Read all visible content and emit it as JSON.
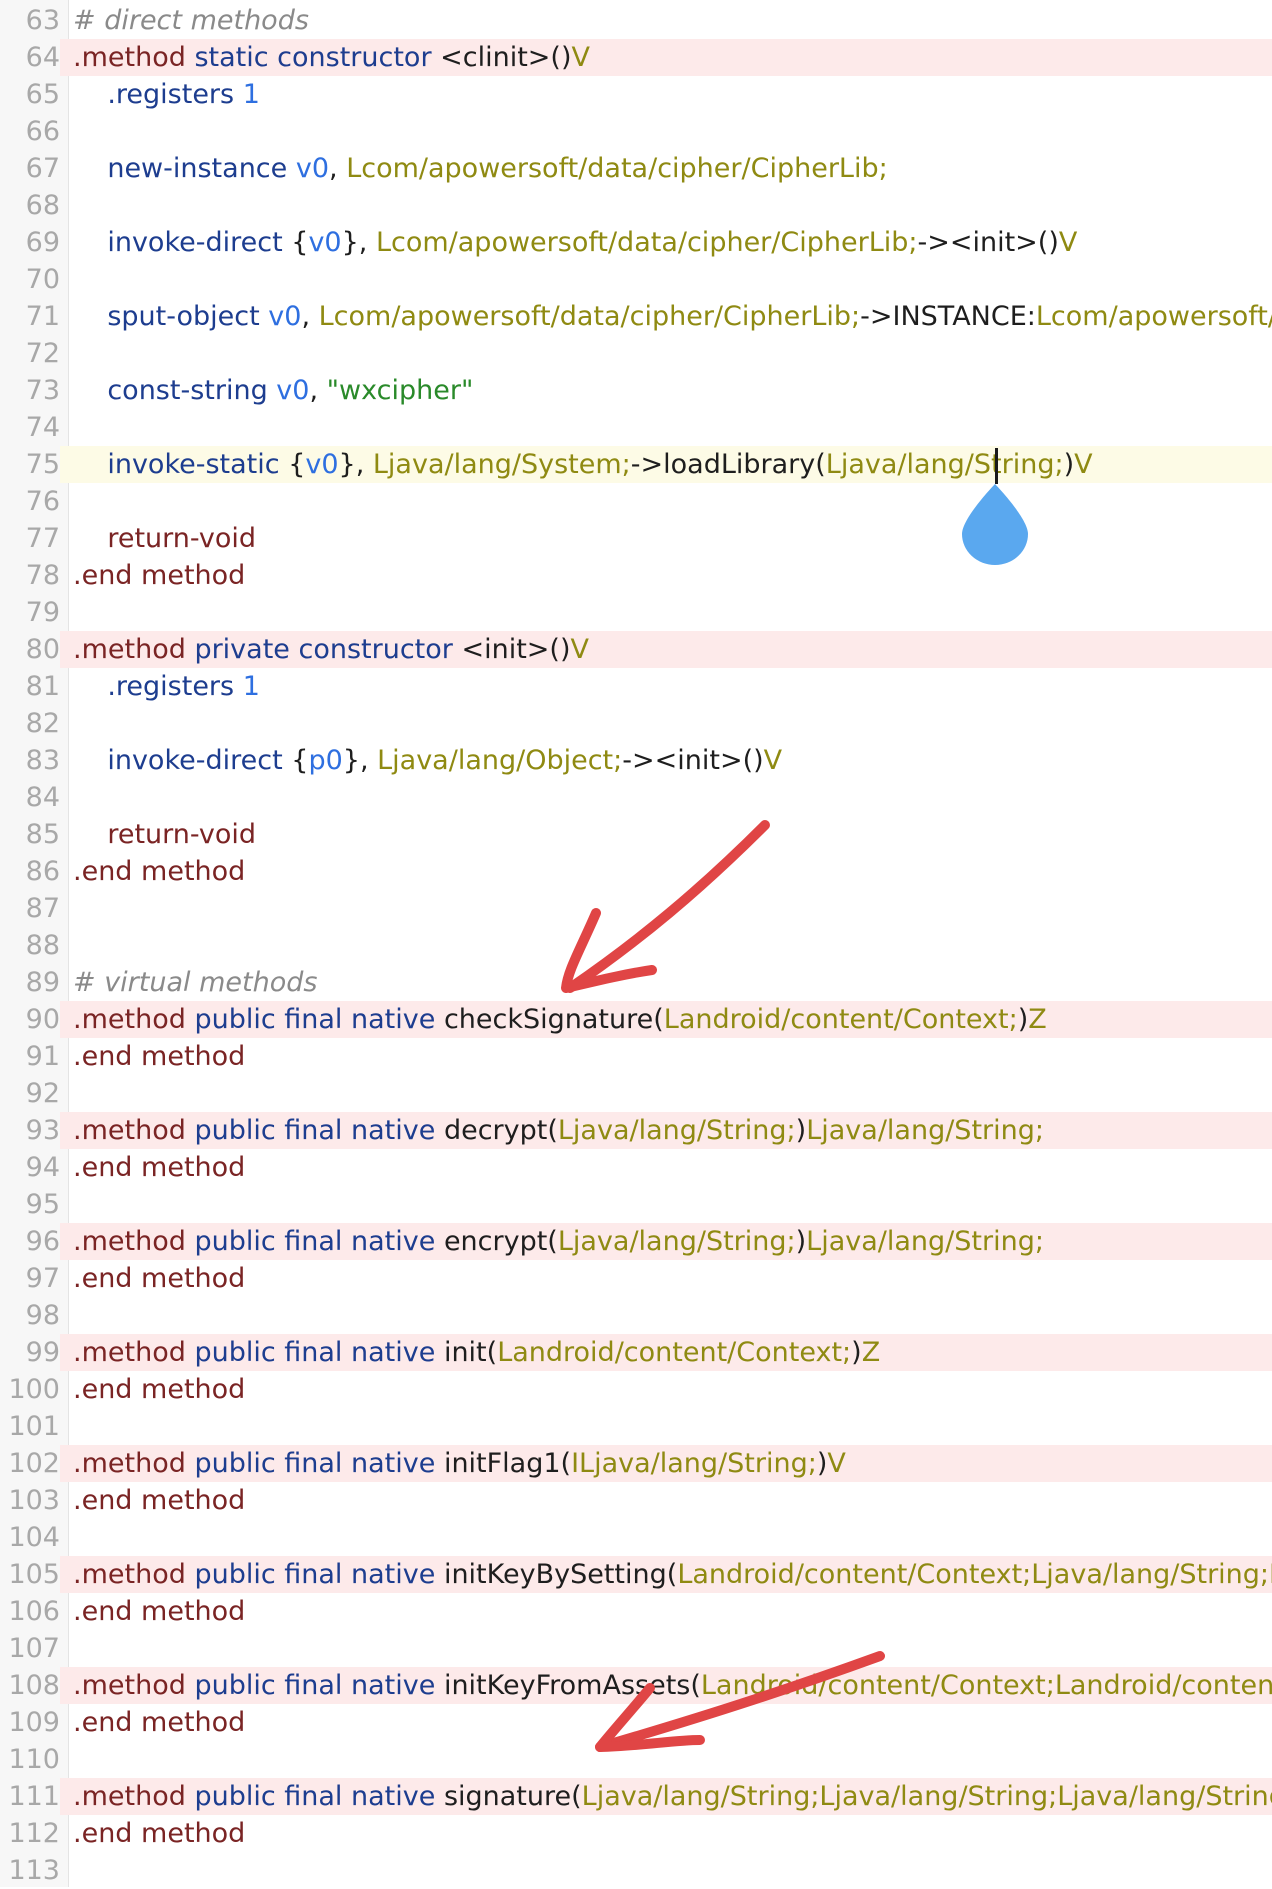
{
  "editor": {
    "lines": [
      {
        "n": "63",
        "hl": "",
        "tokens": [
          {
            "c": "t-comment",
            "t": "# direct methods"
          }
        ]
      },
      {
        "n": "64",
        "hl": "method",
        "tokens": [
          {
            "c": "t-dir",
            "t": ".method "
          },
          {
            "c": "t-kw",
            "t": "static constructor "
          },
          {
            "c": "t-plain",
            "t": "<clinit>()"
          },
          {
            "c": "t-type",
            "t": "V"
          }
        ]
      },
      {
        "n": "65",
        "hl": "",
        "tokens": [
          {
            "c": "t-op",
            "t": "    .registers "
          },
          {
            "c": "t-reg",
            "t": "1"
          }
        ]
      },
      {
        "n": "66",
        "hl": "",
        "tokens": []
      },
      {
        "n": "67",
        "hl": "",
        "tokens": [
          {
            "c": "t-op",
            "t": "    new-instance "
          },
          {
            "c": "t-reg",
            "t": "v0"
          },
          {
            "c": "t-plain",
            "t": ", "
          },
          {
            "c": "t-type",
            "t": "Lcom/apowersoft/data/cipher/CipherLib;"
          }
        ]
      },
      {
        "n": "68",
        "hl": "",
        "tokens": []
      },
      {
        "n": "69",
        "hl": "",
        "tokens": [
          {
            "c": "t-op",
            "t": "    invoke-direct "
          },
          {
            "c": "t-plain",
            "t": "{"
          },
          {
            "c": "t-reg",
            "t": "v0"
          },
          {
            "c": "t-plain",
            "t": "}, "
          },
          {
            "c": "t-type",
            "t": "Lcom/apowersoft/data/cipher/CipherLib;"
          },
          {
            "c": "t-plain",
            "t": "-><init>()"
          },
          {
            "c": "t-type",
            "t": "V"
          }
        ]
      },
      {
        "n": "70",
        "hl": "",
        "tokens": []
      },
      {
        "n": "71",
        "hl": "",
        "tokens": [
          {
            "c": "t-op",
            "t": "    sput-object "
          },
          {
            "c": "t-reg",
            "t": "v0"
          },
          {
            "c": "t-plain",
            "t": ", "
          },
          {
            "c": "t-type",
            "t": "Lcom/apowersoft/data/cipher/CipherLib;"
          },
          {
            "c": "t-plain",
            "t": "->INSTANCE:"
          },
          {
            "c": "t-type",
            "t": "Lcom/apowersoft/data/"
          }
        ]
      },
      {
        "n": "72",
        "hl": "",
        "tokens": []
      },
      {
        "n": "73",
        "hl": "",
        "tokens": [
          {
            "c": "t-op",
            "t": "    const-string "
          },
          {
            "c": "t-reg",
            "t": "v0"
          },
          {
            "c": "t-plain",
            "t": ", "
          },
          {
            "c": "t-str",
            "t": "\"wxcipher\""
          }
        ]
      },
      {
        "n": "74",
        "hl": "",
        "tokens": []
      },
      {
        "n": "75",
        "hl": "cursor",
        "tokens": [
          {
            "c": "t-op",
            "t": "    invoke-static "
          },
          {
            "c": "t-plain",
            "t": "{"
          },
          {
            "c": "t-reg",
            "t": "v0"
          },
          {
            "c": "t-plain",
            "t": "}, "
          },
          {
            "c": "t-type",
            "t": "Ljava/lang/System;"
          },
          {
            "c": "t-plain",
            "t": "->loadLibrary("
          },
          {
            "c": "t-type",
            "t": "Ljava/lang/String;"
          },
          {
            "c": "t-plain",
            "t": ")"
          },
          {
            "c": "t-type",
            "t": "V"
          }
        ]
      },
      {
        "n": "76",
        "hl": "",
        "tokens": []
      },
      {
        "n": "77",
        "hl": "",
        "tokens": [
          {
            "c": "t-dir",
            "t": "    return-void"
          }
        ]
      },
      {
        "n": "78",
        "hl": "",
        "tokens": [
          {
            "c": "t-dir",
            "t": ".end method"
          }
        ]
      },
      {
        "n": "79",
        "hl": "",
        "tokens": []
      },
      {
        "n": "80",
        "hl": "method",
        "tokens": [
          {
            "c": "t-dir",
            "t": ".method "
          },
          {
            "c": "t-kw",
            "t": "private constructor "
          },
          {
            "c": "t-plain",
            "t": "<init>()"
          },
          {
            "c": "t-type",
            "t": "V"
          }
        ]
      },
      {
        "n": "81",
        "hl": "",
        "tokens": [
          {
            "c": "t-op",
            "t": "    .registers "
          },
          {
            "c": "t-reg",
            "t": "1"
          }
        ]
      },
      {
        "n": "82",
        "hl": "",
        "tokens": []
      },
      {
        "n": "83",
        "hl": "",
        "tokens": [
          {
            "c": "t-op",
            "t": "    invoke-direct "
          },
          {
            "c": "t-plain",
            "t": "{"
          },
          {
            "c": "t-reg",
            "t": "p0"
          },
          {
            "c": "t-plain",
            "t": "}, "
          },
          {
            "c": "t-type",
            "t": "Ljava/lang/Object;"
          },
          {
            "c": "t-plain",
            "t": "-><init>()"
          },
          {
            "c": "t-type",
            "t": "V"
          }
        ]
      },
      {
        "n": "84",
        "hl": "",
        "tokens": []
      },
      {
        "n": "85",
        "hl": "",
        "tokens": [
          {
            "c": "t-dir",
            "t": "    return-void"
          }
        ]
      },
      {
        "n": "86",
        "hl": "",
        "tokens": [
          {
            "c": "t-dir",
            "t": ".end method"
          }
        ]
      },
      {
        "n": "87",
        "hl": "",
        "tokens": []
      },
      {
        "n": "88",
        "hl": "",
        "tokens": []
      },
      {
        "n": "89",
        "hl": "",
        "tokens": [
          {
            "c": "t-comment",
            "t": "# virtual methods"
          }
        ]
      },
      {
        "n": "90",
        "hl": "method",
        "tokens": [
          {
            "c": "t-dir",
            "t": ".method "
          },
          {
            "c": "t-kw",
            "t": "public final native "
          },
          {
            "c": "t-plain",
            "t": "checkSignature("
          },
          {
            "c": "t-type",
            "t": "Landroid/content/Context;"
          },
          {
            "c": "t-plain",
            "t": ")"
          },
          {
            "c": "t-type",
            "t": "Z"
          }
        ]
      },
      {
        "n": "91",
        "hl": "",
        "tokens": [
          {
            "c": "t-dir",
            "t": ".end method"
          }
        ]
      },
      {
        "n": "92",
        "hl": "",
        "tokens": []
      },
      {
        "n": "93",
        "hl": "method",
        "tokens": [
          {
            "c": "t-dir",
            "t": ".method "
          },
          {
            "c": "t-kw",
            "t": "public final native "
          },
          {
            "c": "t-plain",
            "t": "decrypt("
          },
          {
            "c": "t-type",
            "t": "Ljava/lang/String;"
          },
          {
            "c": "t-plain",
            "t": ")"
          },
          {
            "c": "t-type",
            "t": "Ljava/lang/String;"
          }
        ]
      },
      {
        "n": "94",
        "hl": "",
        "tokens": [
          {
            "c": "t-dir",
            "t": ".end method"
          }
        ]
      },
      {
        "n": "95",
        "hl": "",
        "tokens": []
      },
      {
        "n": "96",
        "hl": "method",
        "tokens": [
          {
            "c": "t-dir",
            "t": ".method "
          },
          {
            "c": "t-kw",
            "t": "public final native "
          },
          {
            "c": "t-plain",
            "t": "encrypt("
          },
          {
            "c": "t-type",
            "t": "Ljava/lang/String;"
          },
          {
            "c": "t-plain",
            "t": ")"
          },
          {
            "c": "t-type",
            "t": "Ljava/lang/String;"
          }
        ]
      },
      {
        "n": "97",
        "hl": "",
        "tokens": [
          {
            "c": "t-dir",
            "t": ".end method"
          }
        ]
      },
      {
        "n": "98",
        "hl": "",
        "tokens": []
      },
      {
        "n": "99",
        "hl": "method",
        "tokens": [
          {
            "c": "t-dir",
            "t": ".method "
          },
          {
            "c": "t-kw",
            "t": "public final native "
          },
          {
            "c": "t-plain",
            "t": "init("
          },
          {
            "c": "t-type",
            "t": "Landroid/content/Context;"
          },
          {
            "c": "t-plain",
            "t": ")"
          },
          {
            "c": "t-type",
            "t": "Z"
          }
        ]
      },
      {
        "n": "100",
        "hl": "",
        "tokens": [
          {
            "c": "t-dir",
            "t": ".end method"
          }
        ]
      },
      {
        "n": "101",
        "hl": "",
        "tokens": []
      },
      {
        "n": "102",
        "hl": "method",
        "tokens": [
          {
            "c": "t-dir",
            "t": ".method "
          },
          {
            "c": "t-kw",
            "t": "public final native "
          },
          {
            "c": "t-plain",
            "t": "initFlag1("
          },
          {
            "c": "t-type",
            "t": "ILjava/lang/String;"
          },
          {
            "c": "t-plain",
            "t": ")"
          },
          {
            "c": "t-type",
            "t": "V"
          }
        ]
      },
      {
        "n": "103",
        "hl": "",
        "tokens": [
          {
            "c": "t-dir",
            "t": ".end method"
          }
        ]
      },
      {
        "n": "104",
        "hl": "",
        "tokens": []
      },
      {
        "n": "105",
        "hl": "method",
        "tokens": [
          {
            "c": "t-dir",
            "t": ".method "
          },
          {
            "c": "t-kw",
            "t": "public final native "
          },
          {
            "c": "t-plain",
            "t": "initKeyBySetting("
          },
          {
            "c": "t-type",
            "t": "Landroid/content/Context;Ljava/lang/String;Ljava/lang"
          }
        ]
      },
      {
        "n": "106",
        "hl": "",
        "tokens": [
          {
            "c": "t-dir",
            "t": ".end method"
          }
        ]
      },
      {
        "n": "107",
        "hl": "",
        "tokens": []
      },
      {
        "n": "108",
        "hl": "method",
        "tokens": [
          {
            "c": "t-dir",
            "t": ".method "
          },
          {
            "c": "t-kw",
            "t": "public final native "
          },
          {
            "c": "t-plain",
            "t": "initKeyFromAssets("
          },
          {
            "c": "t-type",
            "t": "Landroid/content/Context;Landroid/content/res/Ass"
          }
        ]
      },
      {
        "n": "109",
        "hl": "",
        "tokens": [
          {
            "c": "t-dir",
            "t": ".end method"
          }
        ]
      },
      {
        "n": "110",
        "hl": "",
        "tokens": []
      },
      {
        "n": "111",
        "hl": "method",
        "tokens": [
          {
            "c": "t-dir",
            "t": ".method "
          },
          {
            "c": "t-kw",
            "t": "public final native "
          },
          {
            "c": "t-plain",
            "t": "signature("
          },
          {
            "c": "t-type",
            "t": "Ljava/lang/String;Ljava/lang/String;Ljava/lang/String;Ljava/lan"
          }
        ]
      },
      {
        "n": "112",
        "hl": "",
        "tokens": [
          {
            "c": "t-dir",
            "t": ".end method"
          }
        ]
      },
      {
        "n": "113",
        "hl": "",
        "tokens": []
      }
    ]
  },
  "colors": {
    "method_highlight": "#fdeaea",
    "cursor_highlight": "#fdfbe6",
    "annotation_arrow": "#e04545",
    "selection_handle": "#5aa8ef"
  },
  "icons": {
    "cursor_handle": "teardrop-handle-icon",
    "annotation": "red-arrow-icon"
  }
}
